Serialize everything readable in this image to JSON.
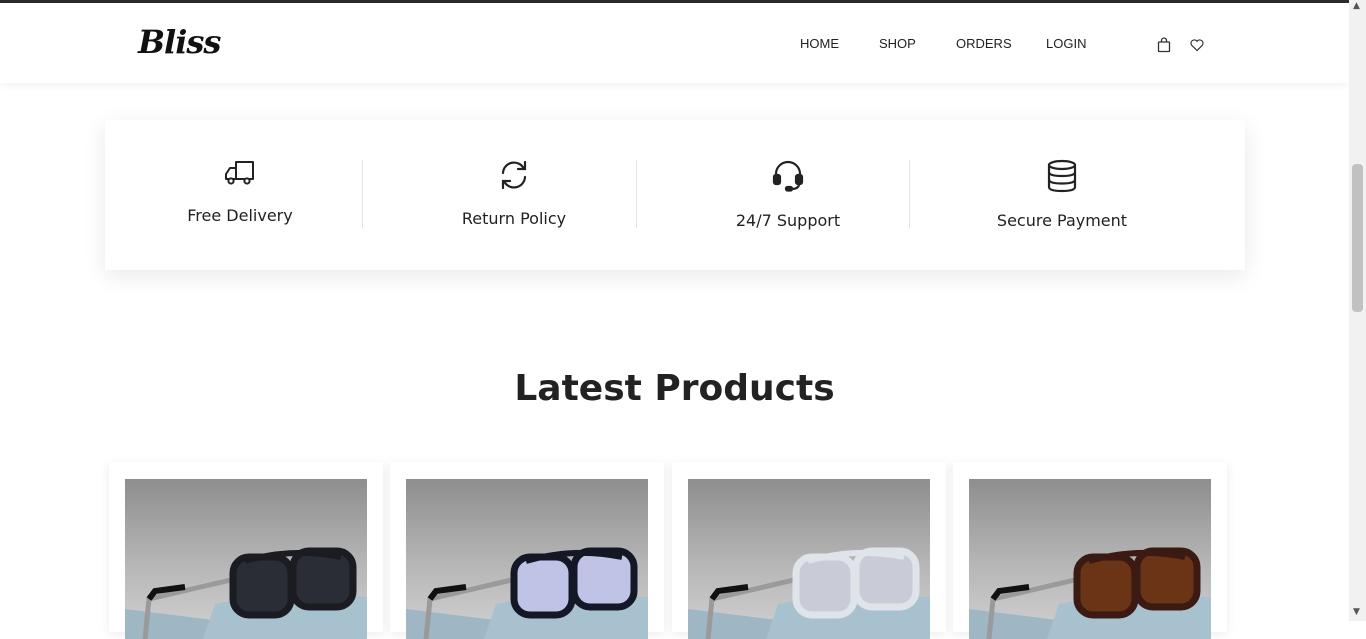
{
  "brand": {
    "logo_text": "Bliss"
  },
  "nav": {
    "home": "HOME",
    "shop": "SHOP",
    "orders": "ORDERS",
    "login": "LOGIN"
  },
  "header_icons": [
    "cart-icon",
    "heart-icon"
  ],
  "features": [
    {
      "label": "Free Delivery",
      "icon": "truck-icon"
    },
    {
      "label": "Return Policy",
      "icon": "refresh-icon"
    },
    {
      "label": "24/7 Support",
      "icon": "headset-icon"
    },
    {
      "label": "Secure Payment",
      "icon": "database-icon"
    }
  ],
  "section": {
    "title": "Latest Products"
  },
  "products": [
    {
      "frame_color": "#1b1c22",
      "lens_color": "#2a2d36"
    },
    {
      "frame_color": "#141726",
      "lens_color": "#bfc3e6"
    },
    {
      "frame_color": "#dfe4ea",
      "lens_color": "#c9ccd6"
    },
    {
      "frame_color": "#3a1a12",
      "lens_color": "#6b3416"
    }
  ],
  "colors": {
    "accent": "#222222",
    "background": "#ffffff",
    "topline": "#2b2b2b"
  }
}
